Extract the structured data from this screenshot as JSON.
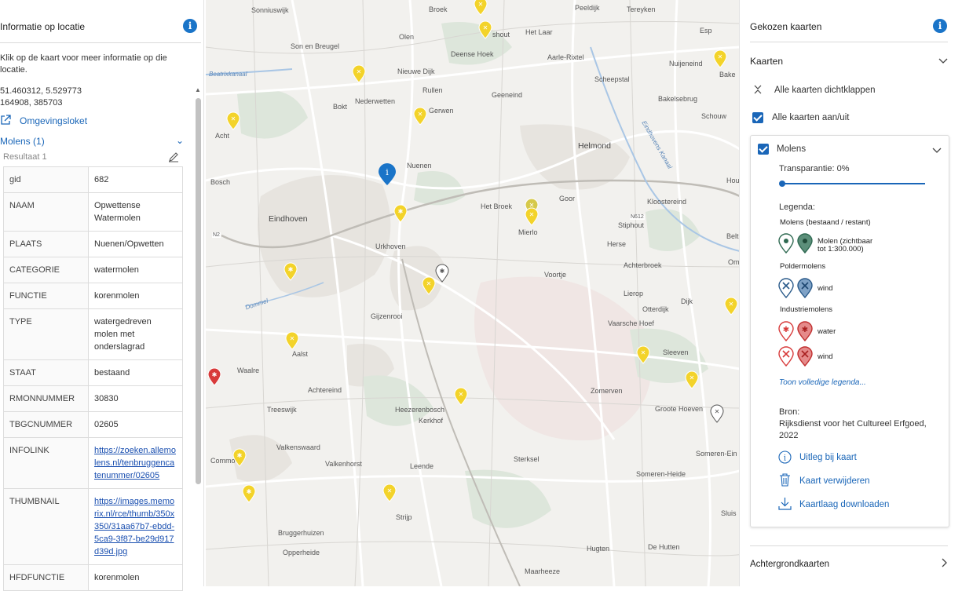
{
  "left_panel": {
    "title": "Informatie op locatie",
    "intro": "Klik op de kaart voor meer informatie op die locatie.",
    "coord_wgs": "51.460312, 5.529773",
    "coord_rd": "164908, 385703",
    "omgevingsloket_link": "Omgevingsloket",
    "section_title": "Molens (1)",
    "result_label": "Resultaat 1",
    "rows": [
      {
        "key": "gid",
        "value": "682"
      },
      {
        "key": "NAAM",
        "value": "Opwettense Watermolen"
      },
      {
        "key": "PLAATS",
        "value": "Nuenen/Opwetten"
      },
      {
        "key": "CATEGORIE",
        "value": "watermolen"
      },
      {
        "key": "FUNCTIE",
        "value": "korenmolen"
      },
      {
        "key": "TYPE",
        "value": "watergedreven molen met onderslagrad"
      },
      {
        "key": "STAAT",
        "value": "bestaand"
      },
      {
        "key": "RMONNUMMER",
        "value": "30830"
      },
      {
        "key": "TBGCNUMMER",
        "value": "02605"
      },
      {
        "key": "INFOLINK",
        "value": "https://zoeken.allemolens.nl/tenbruggencatenummer/02605"
      },
      {
        "key": "THUMBNAIL",
        "value": "https://images.memorix.nl/rce/thumb/350x350/31aa67b7-ebdd-5ca9-3f87-be29d917d39d.jpg"
      },
      {
        "key": "HFDFUNCTIE",
        "value": "korenmolen"
      }
    ]
  },
  "right_panel": {
    "title": "Gekozen kaarten",
    "kaarten_label": "Kaarten",
    "collapse_all": "Alle kaarten dichtklappen",
    "toggle_all": "Alle kaarten aan/uit",
    "layer_name": "Molens",
    "transparency_label": "Transparantie: 0%",
    "transparency_value": 0,
    "legend_title": "Legenda:",
    "legend_group1": "Molens (bestaand / restant)",
    "legend_item1_line1": "Molen (zichtbaar",
    "legend_item1_line2": "tot 1:300.000)",
    "legend_group2": "Poldermolens",
    "legend_item2": "wind",
    "legend_group3": "Industriemolens",
    "legend_item3": "water",
    "legend_item4": "wind",
    "full_legend_link": "Toon volledige legenda...",
    "source_label": "Bron:",
    "source_text": "Rijksdienst voor het Cultureel Erfgoed, 2022",
    "action_explain": "Uitleg bij kaart",
    "action_remove": "Kaart verwijderen",
    "action_download": "Kaartlaag downloaden",
    "background_maps": "Achtergrondkaarten"
  },
  "map": {
    "places": [
      "Sonniuswijk",
      "Broek",
      "Peeldijk",
      "Tereyken",
      "Son en Breugel",
      "Olen",
      "Het Laar",
      "Esp",
      "Deense Hoek",
      "Aarle-Rixtel",
      "Nieuwe Dijk",
      "Rullen",
      "Geeneind",
      "Scheepstal",
      "Nuijeneind",
      "Bakelsebrug",
      "Nederwetten",
      "Bokt",
      "Gerwen",
      "Schouw",
      "Acht",
      "Helmond",
      "Nuenen",
      "Bake",
      "Eindhoven",
      "Het Broek",
      "Goor",
      "Kloostereind",
      "Stiphout",
      "Mierlo",
      "Urkhoven",
      "Herse",
      "Achterbroek",
      "Voortje",
      "Lierop",
      "Gijzenrooi",
      "Otterdijk",
      "Dijk",
      "Vaarsche Hoef",
      "Sleeven",
      "Aalst",
      "Waalre",
      "Achtereind",
      "Zomerven",
      "Treeswijk",
      "Heezerenbosch",
      "Kerkhof",
      "Groote Hoeven",
      "Valkenswaard",
      "Valkenhorst",
      "Leende",
      "Sterksel",
      "Someren-Ein",
      "Someren-Heide",
      "Strijp",
      "Bruggerhuizen",
      "Opperheide",
      "Hugten",
      "De Hutten",
      "Maarheeze",
      "Sluis",
      "Hout",
      "Om",
      "Belt",
      "Commo",
      "Bosch",
      "shout"
    ],
    "road_labels": [
      "N2",
      "N612"
    ],
    "water_labels": [
      "Beatrixkanaal",
      "Dommel",
      "Eindhovens Kanaal"
    ]
  },
  "colors": {
    "accent": "#1a66b8",
    "mill_yellow": "#f3d32a",
    "mill_green": "#2f6a52",
    "mill_red": "#d83a3a"
  }
}
